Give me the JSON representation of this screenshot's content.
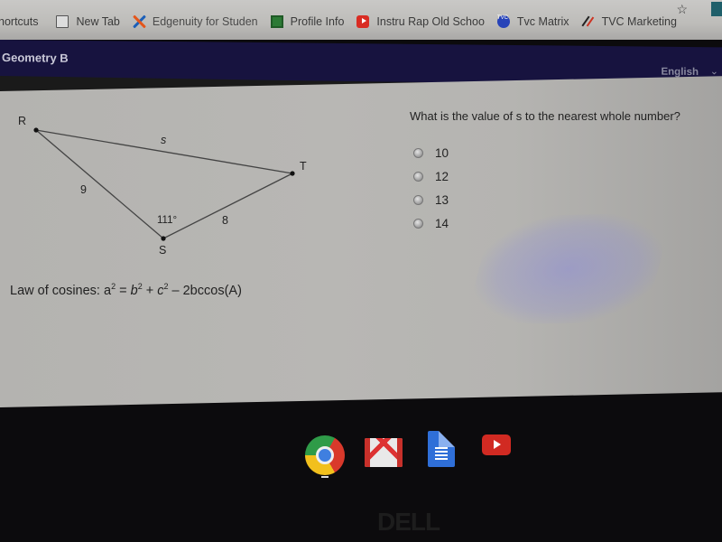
{
  "browser": {
    "bookmarks": [
      {
        "label": "hortcuts",
        "icon": "apps-icon"
      },
      {
        "label": "New Tab",
        "icon": "page-icon"
      },
      {
        "label": "Edgenuity for Studen",
        "icon": "edgenuity-icon"
      },
      {
        "label": "Profile Info",
        "icon": "profile-icon"
      },
      {
        "label": "Instru Rap Old Schoo",
        "icon": "youtube-icon"
      },
      {
        "label": "Tvc Matrix",
        "icon": "tvc-icon"
      },
      {
        "label": "TVC Marketing",
        "icon": "tvc-marketing-icon"
      }
    ],
    "tvc_icon_text": "TVC",
    "star_glyph": "☆"
  },
  "app": {
    "course_title": "Geometry B",
    "language": "English",
    "language_chevron": "⌄"
  },
  "problem": {
    "triangle": {
      "vertices": {
        "R": "R",
        "S": "S",
        "T": "T"
      },
      "side_RT": "s",
      "side_RS": "9",
      "side_ST": "8",
      "angle_S": "111°"
    },
    "question": "What is the value of s to the nearest whole number?",
    "options": [
      "10",
      "12",
      "13",
      "14"
    ],
    "selected": null,
    "hint_prefix": "Law of cosines: ",
    "hint_formula": {
      "a": "a",
      "b": "b",
      "c": "c",
      "exp": "2",
      "eq": " = ",
      "plus": " + ",
      "minus": " – 2bccos(A)"
    }
  },
  "shelf": {
    "apps": [
      "Chrome",
      "Gmail",
      "Google Docs",
      "YouTube"
    ],
    "brand": "DELL"
  }
}
